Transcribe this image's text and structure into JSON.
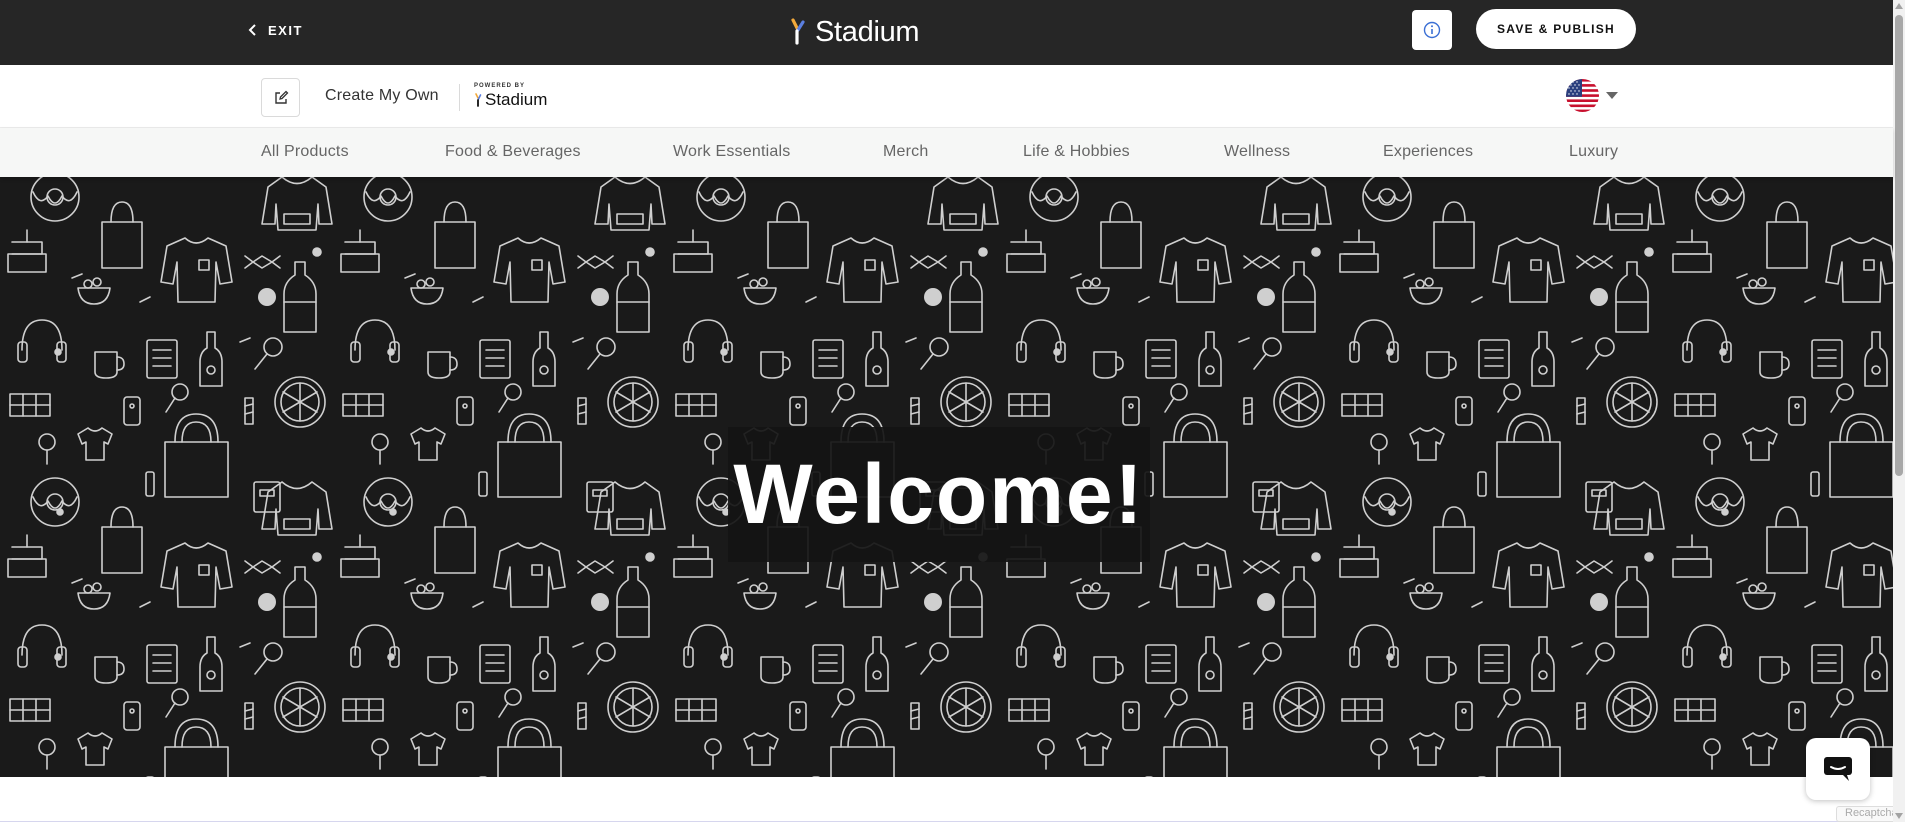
{
  "topbar": {
    "exit_label": "EXIT",
    "exit_icon": "chevron-left-icon",
    "brand_name": "Stadium",
    "info_icon": "info-icon",
    "publish_label": "SAVE & PUBLISH"
  },
  "subbar": {
    "edit_icon": "edit-icon",
    "create_label": "Create My Own",
    "powered_by": "POWERED BY",
    "powered_brand": "Stadium",
    "flag_icon": "us-flag-icon",
    "caret_icon": "caret-down-icon"
  },
  "categories": [
    "All Products",
    "Food & Beverages",
    "Work Essentials",
    "Merch",
    "Life & Hobbies",
    "Wellness",
    "Experiences",
    "Luxury"
  ],
  "hero": {
    "headline": "Welcome!",
    "pattern_icons": [
      "donut",
      "hoodie",
      "tote-bag",
      "sweatshirt",
      "cake",
      "bottle",
      "headphones",
      "mug",
      "notepad",
      "lollipop",
      "pizza",
      "chocolate",
      "t-shirt",
      "phone",
      "candy"
    ]
  },
  "chat": {
    "icon": "chat-icon"
  },
  "recaptcha": {
    "label": "Recaptcha"
  },
  "colors": {
    "topbar_bg": "#262626",
    "hero_bg": "#1a1a1a",
    "nav_bg": "#f6f7f6",
    "accent_blue": "#3b6fd4"
  }
}
